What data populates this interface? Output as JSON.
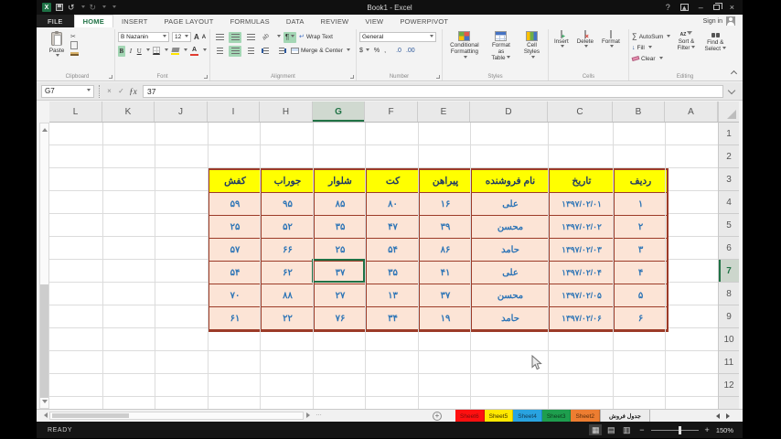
{
  "titlebar": {
    "title": "Book1 - Excel",
    "sign_in": "Sign in",
    "help_icon": "?",
    "minimize_icon": "–",
    "close_icon": "×"
  },
  "ribbon_tabs": [
    {
      "label": "FILE",
      "file": true,
      "active": false
    },
    {
      "label": "HOME",
      "file": false,
      "active": true
    },
    {
      "label": "INSERT",
      "file": false,
      "active": false
    },
    {
      "label": "PAGE LAYOUT",
      "file": false,
      "active": false
    },
    {
      "label": "FORMULAS",
      "file": false,
      "active": false
    },
    {
      "label": "DATA",
      "file": false,
      "active": false
    },
    {
      "label": "REVIEW",
      "file": false,
      "active": false
    },
    {
      "label": "VIEW",
      "file": false,
      "active": false
    },
    {
      "label": "POWERPIVOT",
      "file": false,
      "active": false
    }
  ],
  "ribbon": {
    "clipboard": {
      "group_label": "Clipboard",
      "paste": "Paste",
      "cut_icon": "✂"
    },
    "font": {
      "group_label": "Font",
      "font_name": "B Nazanin",
      "font_size": "12",
      "grow": "A",
      "shrink": "A",
      "bold": "B",
      "italic": "I",
      "underline": "U",
      "font_color_letter": "A",
      "fill_bar_color": "#ffe400",
      "font_bar_color": "#e03c31"
    },
    "alignment": {
      "group_label": "Alignment",
      "wrap_text": "Wrap Text",
      "merge_center": "Merge & Center",
      "orientation_icon": "ab",
      "rtl_icon": "¶",
      "wrap_icon": "↵"
    },
    "number": {
      "group_label": "Number",
      "format": "General",
      "currency": "$",
      "percent": "%",
      "comma": ",",
      "inc_decimal": ".0",
      "dec_decimal": ".00"
    },
    "styles": {
      "group_label": "Styles",
      "conditional_1": "Conditional",
      "conditional_2": "Formatting",
      "format_table_1": "Format as",
      "format_table_2": "Table",
      "cell_styles_1": "Cell",
      "cell_styles_2": "Styles"
    },
    "cells": {
      "group_label": "Cells",
      "insert": "Insert",
      "delete": "Delete",
      "format": "Format",
      "insert_sym": "+",
      "delete_sym": "×"
    },
    "editing": {
      "group_label": "Editing",
      "autosum": "AutoSum",
      "autosum_icon": "∑",
      "fill": "Fill",
      "fill_icon": "↓",
      "clear": "Clear",
      "sort_1": "Sort &",
      "sort_2": "Filter",
      "sort_az": "AZ",
      "find_1": "Find &",
      "find_2": "Select"
    }
  },
  "formula_bar": {
    "name_box": "G7",
    "formula": "37",
    "cancel_icon": "×",
    "enter_icon": "✓",
    "fx_icon": "ƒx"
  },
  "grid": {
    "columns": [
      "L",
      "K",
      "J",
      "I",
      "H",
      "G",
      "F",
      "E",
      "D",
      "C",
      "B",
      "A"
    ],
    "selected_column": "G",
    "rows": [
      "1",
      "2",
      "3",
      "4",
      "5",
      "6",
      "7",
      "8",
      "9",
      "10",
      "11",
      "12"
    ],
    "selected_row": "7"
  },
  "table": {
    "headers": [
      "کفش",
      "جوراب",
      "شلوار",
      "کت",
      "پیراهن",
      "نام فروشنده",
      "تاریخ",
      "ردیف"
    ],
    "rows": [
      [
        "۵۹",
        "۹۵",
        "۸۵",
        "۸۰",
        "۱۶",
        "علی",
        "۱۳۹۷/۰۲/۰۱",
        "۱"
      ],
      [
        "۲۵",
        "۵۲",
        "۳۵",
        "۴۷",
        "۳۹",
        "محسن",
        "۱۳۹۷/۰۲/۰۲",
        "۲"
      ],
      [
        "۵۷",
        "۶۶",
        "۲۵",
        "۵۴",
        "۸۶",
        "حامد",
        "۱۳۹۷/۰۲/۰۳",
        "۳"
      ],
      [
        "۵۴",
        "۶۲",
        "۳۷",
        "۳۵",
        "۴۱",
        "علی",
        "۱۳۹۷/۰۲/۰۴",
        "۴"
      ],
      [
        "۷۰",
        "۸۸",
        "۲۷",
        "۱۳",
        "۳۷",
        "محسن",
        "۱۳۹۷/۰۲/۰۵",
        "۵"
      ],
      [
        "۶۱",
        "۲۲",
        "۷۶",
        "۳۴",
        "۱۹",
        "حامد",
        "۱۳۹۷/۰۲/۰۶",
        "۶"
      ]
    ],
    "selected": {
      "row": 3,
      "col": 2,
      "value": "۳۷"
    },
    "colors": {
      "header_bg": "#ffff00",
      "header_text": "#1f3864",
      "cell_bg": "#fce4d6",
      "cell_text": "#2e75b6",
      "border": "#9c3b28"
    }
  },
  "sheet_tabs": {
    "add_icon": "+",
    "tabs": [
      {
        "label": "Sheet6",
        "color": "#fe1010",
        "text": "#7a0c0c",
        "active": false
      },
      {
        "label": "Sheet5",
        "color": "#ffe800",
        "text": "#3d3200",
        "active": false
      },
      {
        "label": "Sheet4",
        "color": "#29a3e0",
        "text": "#103a55",
        "active": false
      },
      {
        "label": "Sheet3",
        "color": "#1e9e4e",
        "text": "#0a3a1c",
        "active": false
      },
      {
        "label": "Sheet2",
        "color": "#ed7d31",
        "text": "#5a2c08",
        "active": false
      },
      {
        "label": "جدول فروش",
        "color": "#ececec",
        "text": "#222222",
        "active": true
      }
    ]
  },
  "status_bar": {
    "ready": "READY",
    "zoom": "150%",
    "view_icons": [
      {
        "name": "normal-view-icon",
        "glyph": "▦",
        "active": true
      },
      {
        "name": "page-layout-view-icon",
        "glyph": "▤",
        "active": false
      },
      {
        "name": "page-break-view-icon",
        "glyph": "▥",
        "active": false
      }
    ]
  },
  "theme": {
    "excel_green": "#217346",
    "toggle_green": "#a3d6b4"
  }
}
